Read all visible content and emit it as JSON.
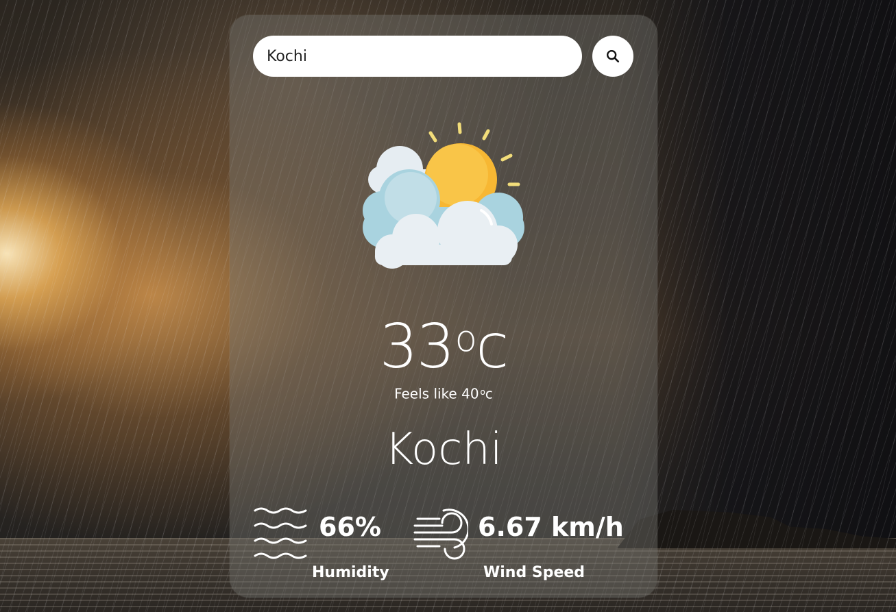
{
  "search": {
    "value": "Kochi",
    "placeholder": ""
  },
  "icons": {
    "search": "search-icon",
    "weather": "sun-behind-clouds-icon",
    "humidity": "waves-icon",
    "wind": "wind-icon"
  },
  "weather": {
    "temperature": "33",
    "temperature_unit_sup": "o",
    "temperature_unit": "c",
    "feels_like_label": "Feels like 40",
    "feels_like_unit_sup": "o",
    "feels_like_unit": "c",
    "city": "Kochi"
  },
  "details": {
    "humidity_value": "66%",
    "humidity_label": "Humidity",
    "wind_value": "6.67 km/h",
    "wind_label": "Wind Speed"
  },
  "colors": {
    "card_bg": "rgba(120,118,115,0.42)",
    "text": "#ffffff",
    "sun": "#f7b733",
    "cloud_light": "#e8eef3",
    "cloud_blue": "#a8d4e0"
  }
}
